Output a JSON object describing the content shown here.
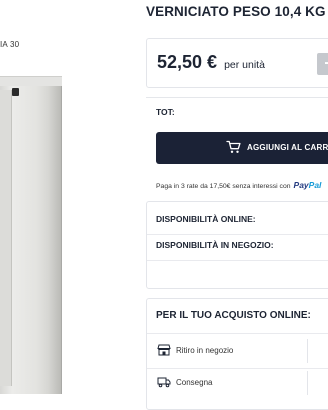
{
  "breadcrumb": {
    "text": "IA 30"
  },
  "product": {
    "title": "VERNICIATO PESO 10,4 KG"
  },
  "price": {
    "value": "52,50 €",
    "unit": "per unità"
  },
  "quantity": {
    "minus_label": "-"
  },
  "total": {
    "label": "TOT:"
  },
  "cart": {
    "button_label": "AGGIUNGI AL CARRE",
    "icon": "cart-icon"
  },
  "installments": {
    "text": "Paga in 3 rate da 17,50€ senza interessi con",
    "paypal_part1": "Pay",
    "paypal_part2": "Pal"
  },
  "availability": {
    "online_label": "DISPONIBILITÀ ONLINE:",
    "store_label": "DISPONIBILITÀ IN NEGOZIO:"
  },
  "purchase": {
    "title": "PER IL TUO ACQUISTO ONLINE:",
    "options": [
      {
        "label": "Ritiro in negozio",
        "icon": "store-icon"
      },
      {
        "label": "Consegna",
        "icon": "truck-icon"
      }
    ]
  },
  "colors": {
    "accent_dark": "#1b2236",
    "text": "#1d2433",
    "paypal_blue_dark": "#253b80",
    "paypal_blue_light": "#179bd7"
  }
}
